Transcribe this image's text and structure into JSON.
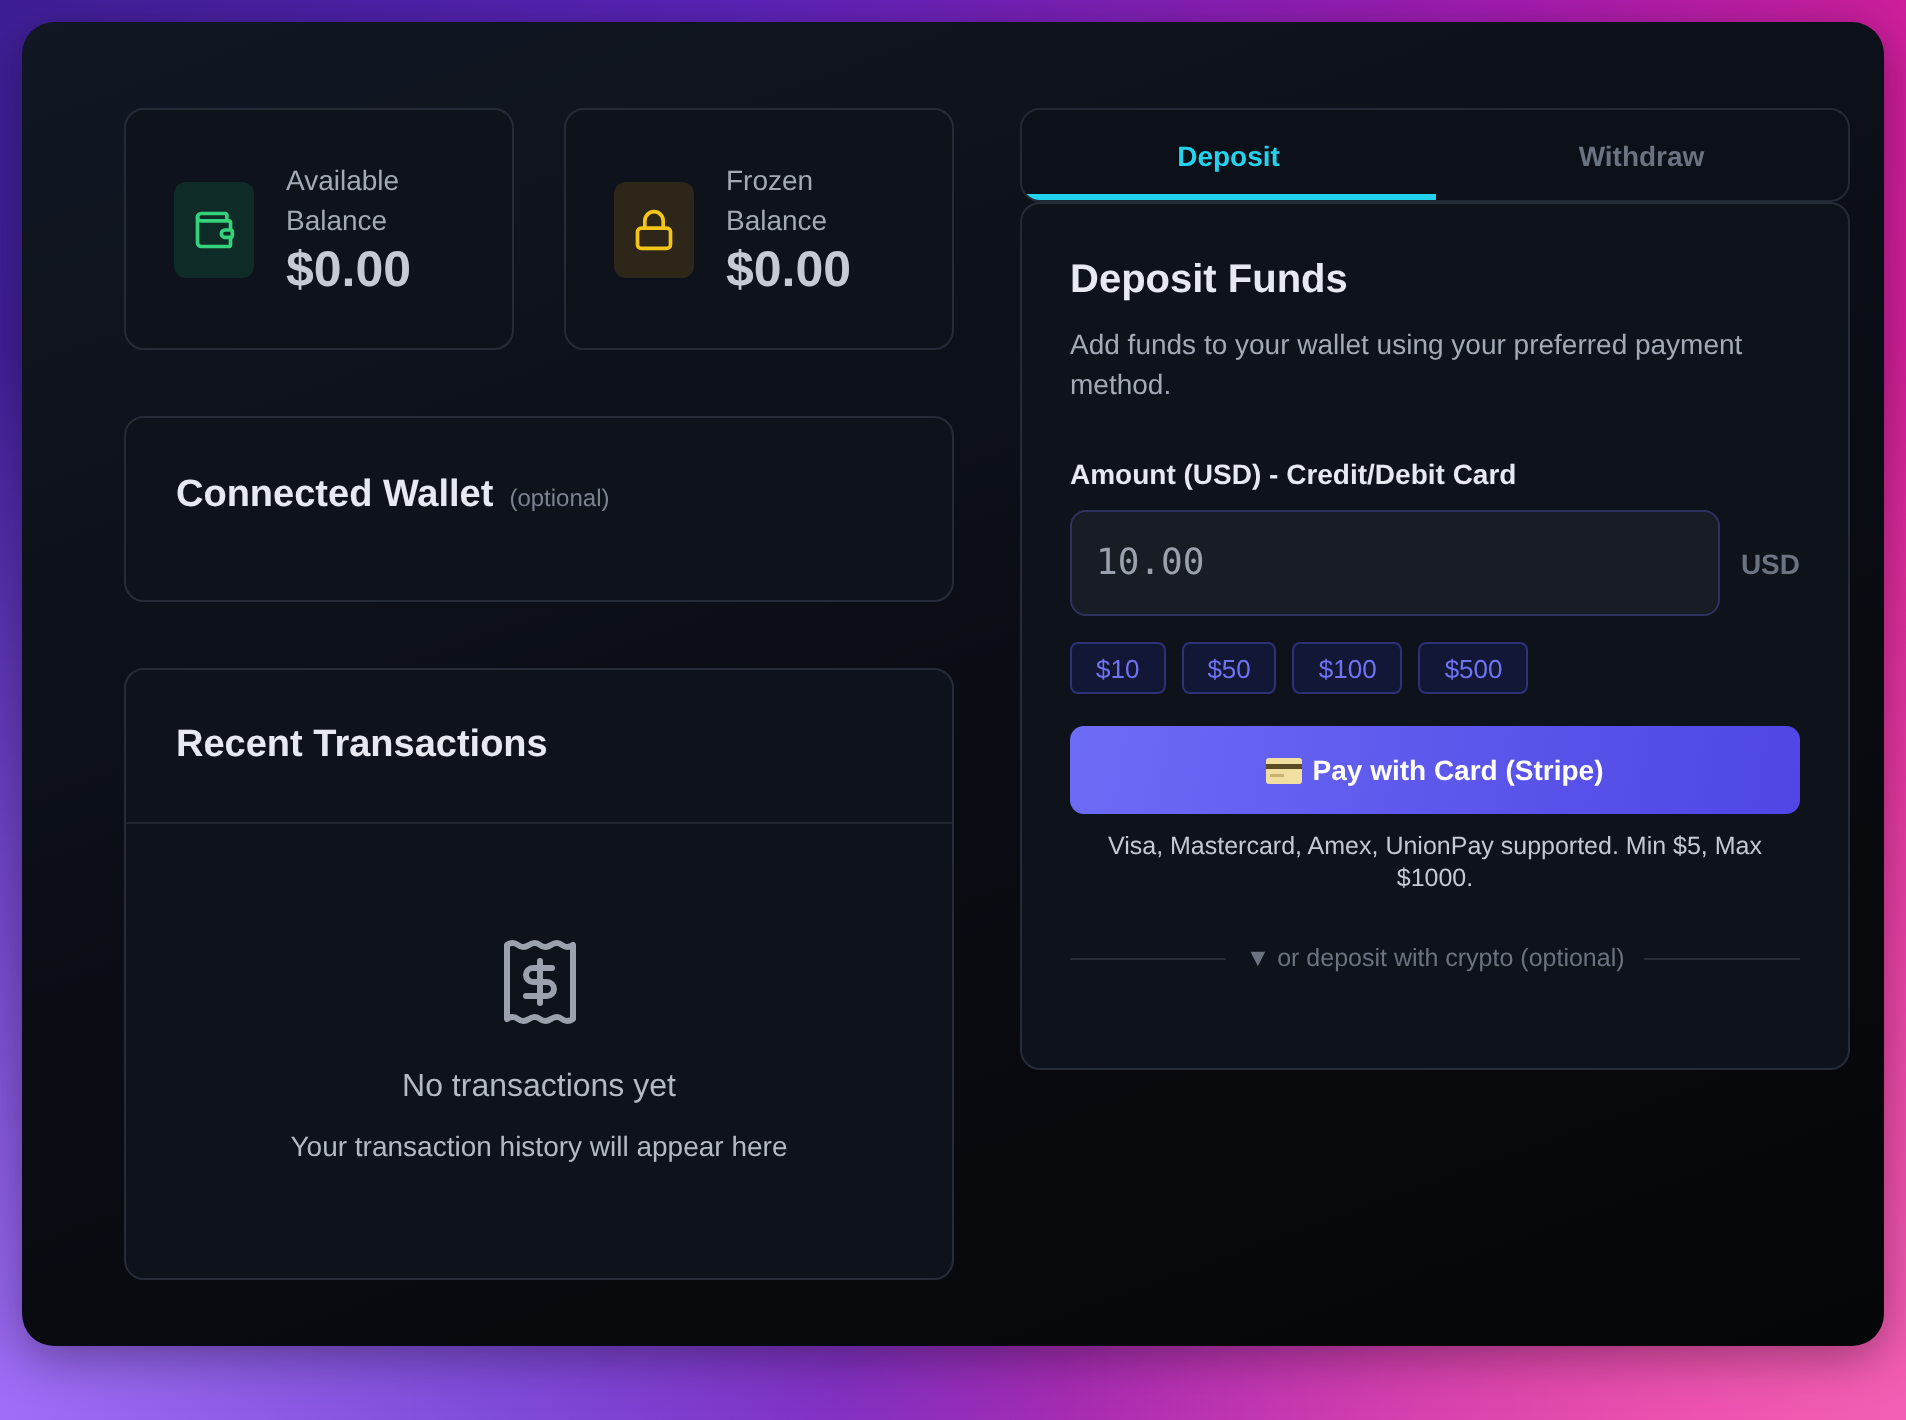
{
  "balances": [
    {
      "kind": "available",
      "label": "Available Balance",
      "amount": "$0.00"
    },
    {
      "kind": "frozen",
      "label": "Frozen Balance",
      "amount": "$0.00"
    }
  ],
  "wallet_card": {
    "title": "Connected Wallet",
    "note": "(optional)"
  },
  "transactions": {
    "title": "Recent Transactions",
    "empty_title": "No transactions yet",
    "empty_text": "Your transaction history will appear here"
  },
  "tabs": [
    {
      "label": "Deposit",
      "selected": true
    },
    {
      "label": "Withdraw",
      "selected": false
    }
  ],
  "deposit": {
    "title": "Deposit Funds",
    "description": "Add funds to your wallet using your preferred payment method.",
    "amount_label": "Amount (USD) - Credit/Debit Card",
    "amount_value": "10.00",
    "currency": "USD",
    "presets": [
      "$10",
      "$50",
      "$100",
      "$500"
    ],
    "pay_button": "Pay with Card (Stripe)",
    "note": "Visa, Mastercard, Amex, UnionPay supported. Min $5, Max $1000.",
    "crypto_divider": "▼ or deposit with crypto (optional)"
  }
}
